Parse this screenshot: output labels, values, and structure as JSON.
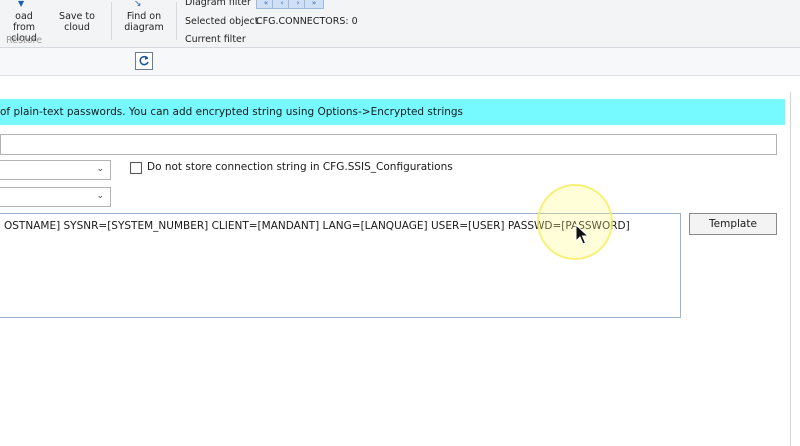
{
  "ribbon": {
    "load_from_cloud": "Load from cloud",
    "load_line1": "oad from",
    "load_line2": "cloud",
    "save_line1": "Save to",
    "save_line2": "cloud",
    "group_restore": "Restore",
    "find_line1": "Find on",
    "find_line2": "diagram",
    "diagram_filter_label": "Diagram filter",
    "nav_buttons": [
      "«",
      "‹",
      "›",
      "»"
    ],
    "selected_object_label": "Selected object",
    "selected_object_value": "CFG.CONNECTORS: 0",
    "current_filter_label": "Current filter"
  },
  "toolbar": {
    "refresh_icon": "refresh-icon"
  },
  "form": {
    "banner_text": "of plain-text passwords. You can add encrypted string using Options->Encrypted strings",
    "name_value": "",
    "dropdown1_value": "",
    "dropdown2_value": "",
    "checkbox_label": "Do not store connection string in CFG.SSIS_Configurations",
    "checkbox_checked": false,
    "connection_string": "OSTNAME] SYSNR=[SYSTEM_NUMBER] CLIENT=[MANDANT] LANG=[LANQUAGE] USER=[USER] PASSWD=[PASSWORD]",
    "template_button": "Template"
  },
  "colors": {
    "banner": "#77faff",
    "ribbon_bg": "#f3f4f6",
    "accent": "#1a5fb4",
    "cursor_highlight": "#fff878"
  }
}
